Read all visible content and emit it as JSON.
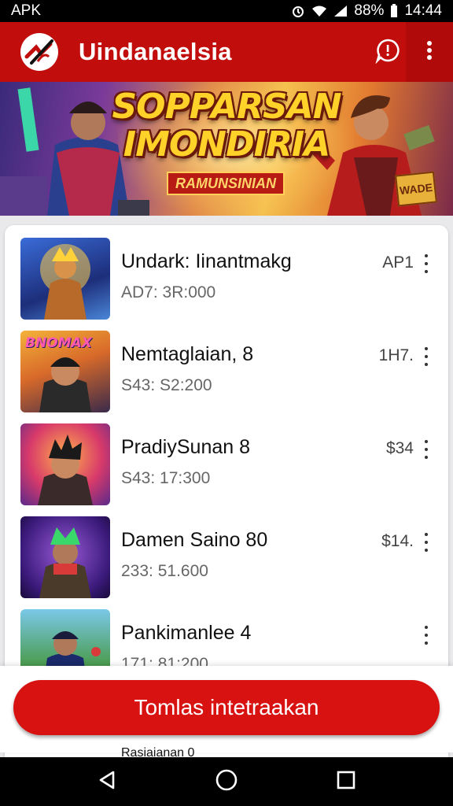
{
  "status_bar": {
    "carrier": "APK",
    "battery": "88%",
    "time": "14:44"
  },
  "app_bar": {
    "title": "Uindanaelsia"
  },
  "banner": {
    "title_line1": "SOPPARSAN",
    "title_line2": "IMONDIRIA",
    "ribbon": "RAMUNSINIAN",
    "badge": "WADE"
  },
  "list": [
    {
      "title": "Undark: Iinantmakg",
      "subtitle": "AD7: 3R:000",
      "price": "AP1",
      "thumb_label": ""
    },
    {
      "title": "Nemtaglaian, 8",
      "subtitle": "S43: S2:200",
      "price": "1H7.",
      "thumb_label": "BNOMAX"
    },
    {
      "title": "PradiySunan 8",
      "subtitle": "S43: 17:300",
      "price": "$34",
      "thumb_label": ""
    },
    {
      "title": "Damen Saino 80",
      "subtitle": "233: 51.600",
      "price": "$14.",
      "thumb_label": ""
    },
    {
      "title": "Pankimanlee 4",
      "subtitle": "171: 81:200",
      "price": "",
      "thumb_label": ""
    }
  ],
  "cta": {
    "label": "Tomlas intetraakan"
  },
  "peek_text": "Rasiaianan 0",
  "icons": [
    "app-logo-icon",
    "chat-icon",
    "more-vert-icon",
    "back-icon",
    "home-icon",
    "recents-icon",
    "wifi-icon",
    "signal-icon",
    "battery-icon",
    "alarm-icon"
  ],
  "colors": {
    "primary": "#c20d0d",
    "cta": "#d81111"
  }
}
